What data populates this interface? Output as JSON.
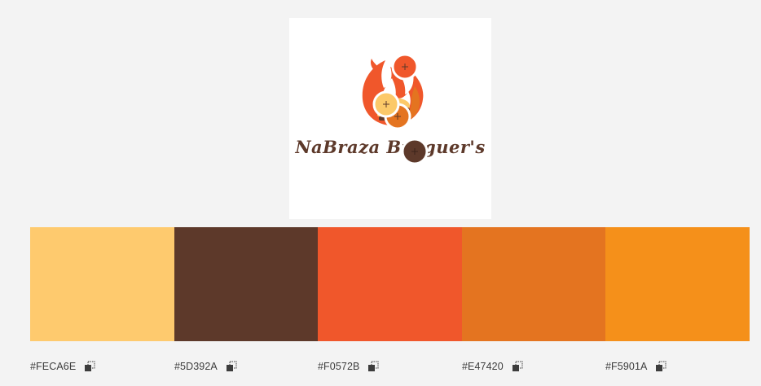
{
  "logo": {
    "wordmark": "NaBraza Burguer's"
  },
  "palette": {
    "swatches": [
      {
        "hex": "#FECA6E",
        "label": "#FECA6E"
      },
      {
        "hex": "#5D392A",
        "label": "#5D392A"
      },
      {
        "hex": "#F0572B",
        "label": "#F0572B"
      },
      {
        "hex": "#E47420",
        "label": "#E47420"
      },
      {
        "hex": "#F5901A",
        "label": "#F5901A"
      }
    ]
  },
  "colors": {
    "background": "#F3F3F3",
    "panel": "#FFFFFF",
    "label_text": "#3C3C3C"
  },
  "icons": {
    "copy": "copy-icon",
    "picker": "color-picker-marker-icon"
  }
}
